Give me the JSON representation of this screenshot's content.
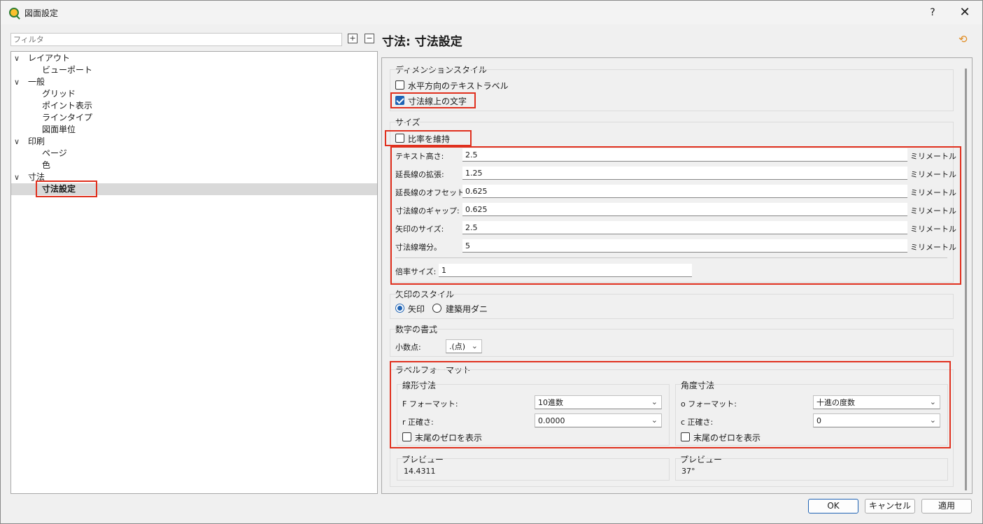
{
  "window": {
    "title": "図面設定",
    "help": "?",
    "close": "✕"
  },
  "filter": {
    "placeholder": "フィルタ"
  },
  "tree": {
    "items": [
      {
        "label": "レイアウト",
        "chevron": "∨"
      },
      {
        "label": "ビューポート"
      },
      {
        "label": "一般",
        "chevron": "∨"
      },
      {
        "label": "グリッド"
      },
      {
        "label": "ポイント表示"
      },
      {
        "label": "ラインタイプ"
      },
      {
        "label": "図面単位"
      },
      {
        "label": "印刷",
        "chevron": "∨"
      },
      {
        "label": "ページ"
      },
      {
        "label": "色"
      },
      {
        "label": "寸法",
        "chevron": "∨"
      },
      {
        "label": "寸法設定",
        "selected": true
      }
    ]
  },
  "page": {
    "title": "寸法: 寸法設定"
  },
  "dimension_style": {
    "title": "ディメンションスタイル",
    "horizontal_text": {
      "label": "水平方向のテキストラベル",
      "checked": false
    },
    "text_on_line": {
      "label": "寸法線上の文字",
      "checked": true
    }
  },
  "size": {
    "title": "サイズ",
    "keep_ratio": {
      "label": "比率を維持",
      "checked": false
    },
    "rows": [
      {
        "label": "テキスト高さ:",
        "value": "2.5",
        "unit": "ミリメートル"
      },
      {
        "label": "延長線の拡張:",
        "value": "1.25",
        "unit": "ミリメートル"
      },
      {
        "label": "延長線のオフセット:",
        "value": "0.625",
        "unit": "ミリメートル"
      },
      {
        "label": "寸法線のギャップ:",
        "value": "0.625",
        "unit": "ミリメートル"
      },
      {
        "label": "矢印のサイズ:",
        "value": "2.5",
        "unit": "ミリメートル"
      },
      {
        "label": "寸法線増分。",
        "value": "5",
        "unit": "ミリメートル"
      }
    ],
    "scale_label": "倍率サイズ:",
    "scale_value": "1"
  },
  "arrow_style": {
    "title": "矢印のスタイル",
    "arrow": {
      "label": "矢印",
      "checked": true
    },
    "tick": {
      "label": "建築用ダニ",
      "checked": false
    }
  },
  "number_format": {
    "title": "数字の書式",
    "decimal_label": "小数点:",
    "decimal_value": ".(点)"
  },
  "label_format": {
    "title": "ラベルフォーマット",
    "linear": {
      "title": "線形寸法",
      "format_label": "F フォーマット:",
      "format_value": "10進数",
      "precision_label": "r 正確さ:",
      "precision_value": "0.0000",
      "trailing_zero": {
        "label": "末尾のゼロを表示",
        "checked": false
      }
    },
    "angular": {
      "title": "角度寸法",
      "format_label": "o フォーマット:",
      "format_value": "十進の度数",
      "precision_label": "c 正確さ:",
      "precision_value": "0",
      "trailing_zero": {
        "label": "末尾のゼロを表示",
        "checked": false
      }
    }
  },
  "preview": {
    "linear": {
      "title": "プレビュー",
      "value": "14.4311"
    },
    "angular": {
      "title": "プレビュー",
      "value": "37°"
    }
  },
  "buttons": {
    "ok": "OK",
    "cancel": "キャンセル",
    "apply": "適用"
  },
  "colors": {
    "accent": "#1f63b4",
    "highlight": "#e0301e",
    "selection": "#d9d9d9"
  }
}
